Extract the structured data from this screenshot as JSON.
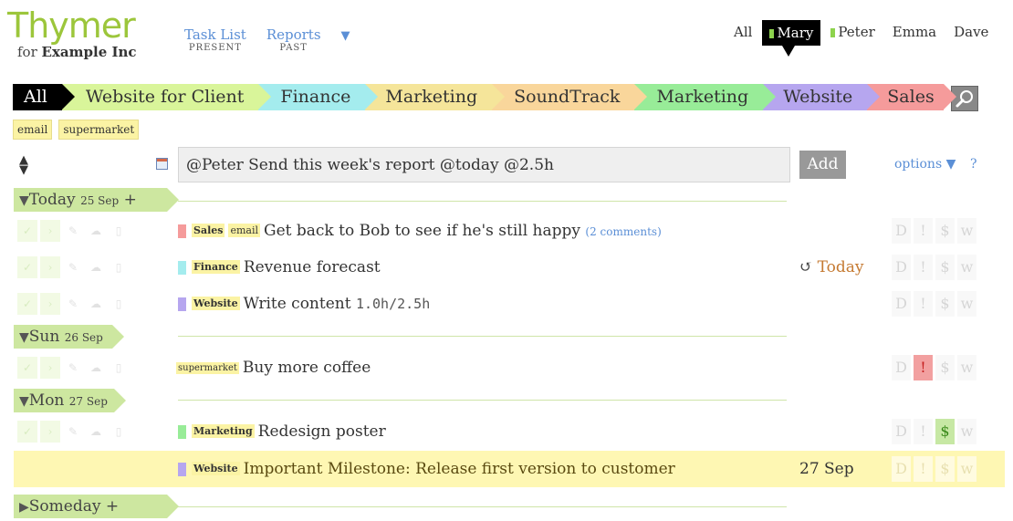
{
  "app": {
    "logo": "Thymer",
    "for_prefix": "for",
    "company": "Example Inc"
  },
  "nav": [
    {
      "label": "Task List",
      "sub": "PRESENT"
    },
    {
      "label": "Reports",
      "sub": "PAST"
    }
  ],
  "nav_more": "▼",
  "users": [
    {
      "label": "All",
      "active": false,
      "marker": false
    },
    {
      "label": "Mary",
      "active": true,
      "marker": true
    },
    {
      "label": "Peter",
      "active": false,
      "marker": true
    },
    {
      "label": "Emma",
      "active": false,
      "marker": false
    },
    {
      "label": "Dave",
      "active": false,
      "marker": false
    }
  ],
  "categories": [
    {
      "label": "All",
      "color": "#000000"
    },
    {
      "label": "Website for Client",
      "color": "#d9f59a"
    },
    {
      "label": "Finance",
      "color": "#a4ecee"
    },
    {
      "label": "Marketing",
      "color": "#f5e59a"
    },
    {
      "label": "SoundTrack",
      "color": "#f9d69b"
    },
    {
      "label": "Marketing",
      "color": "#98ec98"
    },
    {
      "label": "Website",
      "color": "#b6a6ef"
    },
    {
      "label": "Sales",
      "color": "#f59b9b"
    }
  ],
  "tags": [
    "email",
    "supermarket"
  ],
  "input": {
    "value": "@Peter Send this week's report @today @2.5h",
    "add_label": "Add"
  },
  "options_label": "options ▼",
  "help_label": "?",
  "sort_icon": "▲▼",
  "days": {
    "today": {
      "name": "Today",
      "date": "25 Sep",
      "plus": "+",
      "tri": "▼"
    },
    "sun": {
      "name": "Sun",
      "date": "26 Sep",
      "tri": "▼"
    },
    "mon": {
      "name": "Mon",
      "date": "27 Sep",
      "tri": "▼"
    },
    "someday": {
      "name": "Someday",
      "plus": "+",
      "tri": "▶"
    }
  },
  "flag_labels": [
    "D",
    "!",
    "$",
    "w"
  ],
  "action_icons": [
    "check-icon",
    "next-icon",
    "edit-icon",
    "comment-icon",
    "delete-icon"
  ],
  "tasks": [
    {
      "cat": "Sales",
      "cat_color": "#f59b9b",
      "tag": "email",
      "text": "Get back to Bob to see if he's still happy",
      "comments": "2 comments",
      "due": "",
      "flags_on": []
    },
    {
      "cat": "Finance",
      "cat_color": "#a4ecee",
      "tag": "",
      "text": "Revenue forecast",
      "comments": "",
      "due": "Today",
      "due_icon": "↺",
      "flags_on": []
    },
    {
      "cat": "Website",
      "cat_color": "#b6a6ef",
      "tag": "",
      "text": "Write content",
      "time": "1.0h/2.5h",
      "comments": "",
      "due": "",
      "flags_on": []
    },
    {
      "cat": "",
      "cat_color": "",
      "tag": "supermarket",
      "text": "Buy more coffee",
      "comments": "",
      "due": "",
      "flags_on": [
        "!"
      ]
    },
    {
      "cat": "Marketing",
      "cat_color": "#98ec98",
      "tag": "",
      "text": "Redesign poster",
      "comments": "",
      "due": "",
      "flags_on": [
        "$"
      ]
    },
    {
      "cat": "Website",
      "cat_color": "#b6a6ef",
      "tag": "",
      "text": "Important Milestone: Release first version to customer",
      "comments": "",
      "due": "27 Sep",
      "flags_on": [],
      "highlight": true
    }
  ]
}
